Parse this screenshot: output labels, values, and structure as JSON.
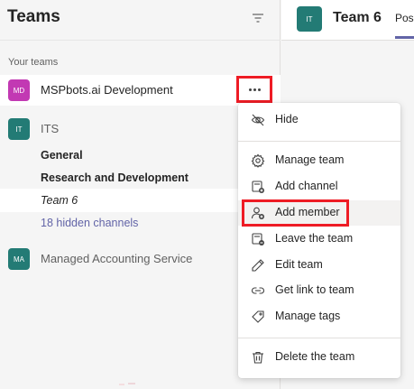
{
  "header": {
    "title": "Teams"
  },
  "sidebar": {
    "section_label": "Your teams",
    "teams": [
      {
        "initials": "MD",
        "name": "MSPbots.ai Development",
        "color": "#c239b3"
      },
      {
        "initials": "IT",
        "name": "ITS",
        "color": "#237b75",
        "channels": [
          {
            "label": "General"
          },
          {
            "label": "Research and Development"
          },
          {
            "label": "Team 6"
          },
          {
            "label": "18 hidden channels"
          }
        ]
      },
      {
        "initials": "MA",
        "name": "Managed Accounting Service",
        "color": "#237b75"
      }
    ]
  },
  "right_header": {
    "avatar_initials": "IT",
    "title": "Team 6",
    "tab": "Pos"
  },
  "context_menu": {
    "items": [
      {
        "label": "Hide",
        "icon": "hide-icon"
      },
      {
        "label": "Manage team",
        "icon": "gear-icon"
      },
      {
        "label": "Add channel",
        "icon": "add-channel-icon"
      },
      {
        "label": "Add member",
        "icon": "add-member-icon"
      },
      {
        "label": "Leave the team",
        "icon": "leave-team-icon"
      },
      {
        "label": "Edit team",
        "icon": "pencil-icon"
      },
      {
        "label": "Get link to team",
        "icon": "link-icon"
      },
      {
        "label": "Manage tags",
        "icon": "tag-icon"
      },
      {
        "label": "Delete the team",
        "icon": "trash-icon"
      }
    ]
  },
  "colors": {
    "accent": "#6264a7",
    "highlight": "#ee1c25"
  }
}
